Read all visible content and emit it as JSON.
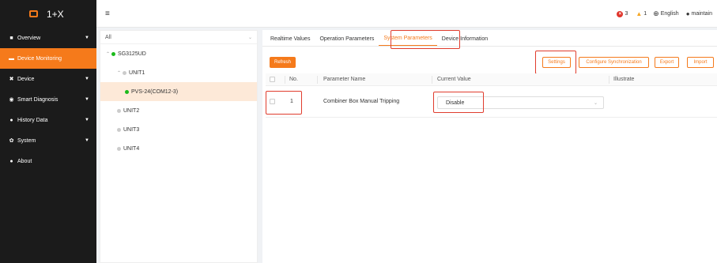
{
  "app": {
    "title": "1+X"
  },
  "colors": {
    "accent": "#f57a1b",
    "sidebar_bg": "#1b1b1b",
    "highlight": "#e03c2d",
    "online": "#1bba1b"
  },
  "sidebar": {
    "items": [
      {
        "label": "Overview",
        "icon": "grid-icon",
        "glyph": "■",
        "caret": "▼",
        "active": false
      },
      {
        "label": "Device Monitoring",
        "icon": "monitor-icon",
        "glyph": "▬",
        "caret": "",
        "active": true
      },
      {
        "label": "Device",
        "icon": "wrench-icon",
        "glyph": "✖",
        "caret": "▼",
        "active": false
      },
      {
        "label": "Smart Diagnosis",
        "icon": "diagnosis-icon",
        "glyph": "◉",
        "caret": "▼",
        "active": false
      },
      {
        "label": "History Data",
        "icon": "history-icon",
        "glyph": "●",
        "caret": "▼",
        "active": false
      },
      {
        "label": "System",
        "icon": "gear-icon",
        "glyph": "✿",
        "caret": "▼",
        "active": false
      },
      {
        "label": "About",
        "icon": "info-icon",
        "glyph": "●",
        "caret": "",
        "active": false
      }
    ]
  },
  "topbar": {
    "menu_glyph": "≡",
    "error_count": "3",
    "warning_count": "1",
    "language": "English",
    "user": "maintain",
    "error_glyph": "×",
    "warning_glyph": "▲",
    "globe_glyph": "⊕",
    "user_glyph": "●"
  },
  "tree": {
    "filter_value": "All",
    "filter_chevron": "⌄",
    "root": "SG3125UD",
    "root_caret": "⌃",
    "unit1": "UNIT1",
    "unit1_caret": "⌃",
    "leaf": "PVS-24(COM12-3)",
    "unit2": "UNIT2",
    "unit3": "UNIT3",
    "unit4": "UNIT4"
  },
  "tabs": {
    "items": [
      "Realtime Values",
      "Operation Parameters",
      "System Parameters",
      "Device Information"
    ],
    "active_index": 2
  },
  "toolbar": {
    "refresh": "Refresh",
    "settings": "Settings",
    "configure_sync": "Configure Synchronization",
    "export": "Export",
    "import": "Import"
  },
  "table": {
    "headers": {
      "no": "No.",
      "name": "Parameter Name",
      "value": "Current Value",
      "illustrate": "Illustrate"
    },
    "rows": [
      {
        "no": "1",
        "name": "Combiner Box Manual Tripping",
        "value": "Disable",
        "illustrate": "",
        "chevron": "⌄"
      }
    ]
  }
}
